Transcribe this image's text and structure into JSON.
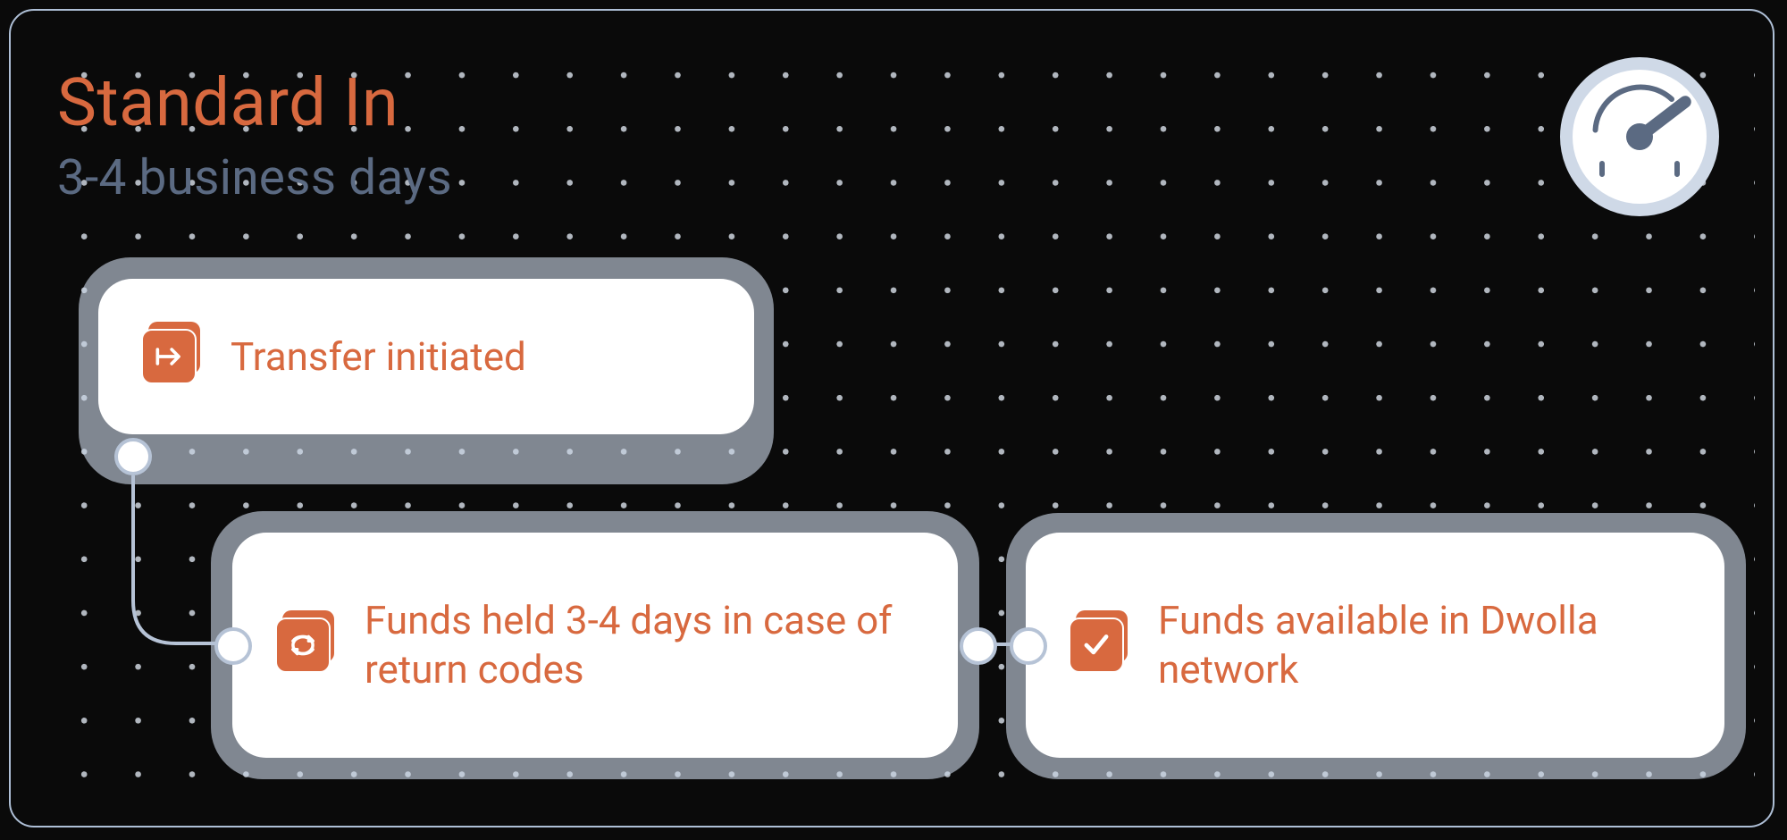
{
  "header": {
    "title": "Standard In",
    "subtitle": "3-4 business days"
  },
  "steps": [
    {
      "icon": "transfer-arrow-icon",
      "label": "Transfer initiated"
    },
    {
      "icon": "cycle-icon",
      "label": "Funds held 3-4 days in case of return codes"
    },
    {
      "icon": "check-icon",
      "label": "Funds available in Dwolla network"
    }
  ],
  "colors": {
    "accent": "#d8693f",
    "muted": "#5b6a82",
    "halo": "#c9d5e5",
    "border": "#aebfd6"
  }
}
